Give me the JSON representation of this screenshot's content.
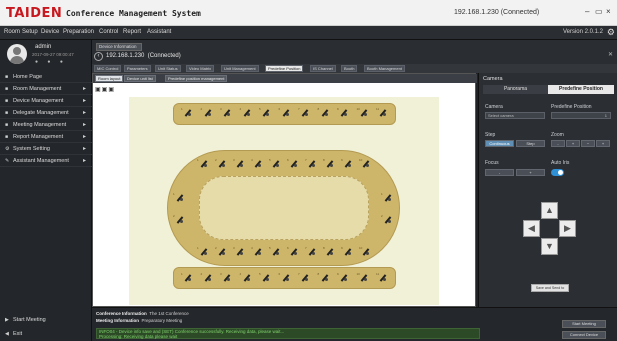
{
  "titlebar": {
    "brand": "TAIDEN",
    "title": "Conference Management System",
    "connection": "192.168.1.230 (Connected)"
  },
  "menubar": {
    "items": [
      "Room",
      "Setup",
      "Device",
      "Preparation",
      "Control",
      "Report",
      "Assistant"
    ],
    "version": "Version 2.0.1.2"
  },
  "user": {
    "name": "admin",
    "date": "2017-09-27 09:00:47",
    "icons": "● ● ●"
  },
  "sidebar": {
    "items": [
      {
        "label": "Home Page",
        "icon": "home-icon"
      },
      {
        "label": "Room Management",
        "icon": "room-icon"
      },
      {
        "label": "Device Management",
        "icon": "device-icon"
      },
      {
        "label": "Delegate Management",
        "icon": "delegate-icon"
      },
      {
        "label": "Meeting Management",
        "icon": "meeting-icon"
      },
      {
        "label": "Report Management",
        "icon": "report-icon"
      },
      {
        "label": "System Setting",
        "icon": "gear-icon"
      },
      {
        "label": "Assistant Management",
        "icon": "assistant-icon"
      }
    ],
    "start_meeting": "Start Meeting",
    "exit": "Exit"
  },
  "infobar": {
    "device_tab": "Device Information",
    "ip": "192.168.1.230",
    "status": "(Connected)"
  },
  "tabs": [
    "MIC Control",
    "Parameters",
    "Unit Status",
    "Video Matrix",
    "Unit Management",
    "Predefine Position",
    "IS Channel",
    "Booth",
    "Booth Management"
  ],
  "active_tab_index": 5,
  "workspace_tabs": [
    "Room layout",
    "Device unit list",
    "Predefine position management"
  ],
  "microphones": {
    "top_row": [
      1,
      2,
      3,
      4,
      5,
      6,
      7,
      8,
      9,
      10,
      11
    ],
    "bottom_row": [
      1,
      2,
      3,
      4,
      5,
      6,
      7,
      8,
      9,
      10,
      11
    ],
    "oval_top": [
      1,
      2,
      3,
      4,
      5,
      6,
      7,
      8,
      9,
      10
    ],
    "oval_bottom": [
      1,
      2,
      3,
      4,
      5,
      6,
      7,
      8,
      9,
      10
    ],
    "oval_left": [
      1,
      2
    ],
    "oval_right": [
      1,
      2
    ]
  },
  "right_panel": {
    "title": "Camera",
    "tabs": [
      "Panorama",
      "Predefine Position"
    ],
    "camera_label": "Camera",
    "camera_select": "Select camera",
    "predefine_label": "Predefine Position",
    "predefine_value": "1",
    "step_label": "Step",
    "step_buttons": [
      "Continuous",
      "Step"
    ],
    "zoom_label": "Zoom",
    "zoom_buttons": [
      "-",
      "+",
      "−",
      "+"
    ],
    "focus_label": "Focus",
    "focus_buttons": [
      "-",
      "+"
    ],
    "autoiris_label": "Auto Iris",
    "preset_button": "Save and Send to PTZ"
  },
  "bottom": {
    "line1_label": "Conference Information",
    "line1_value": "The 1st Conference",
    "line2_label": "Meeting Information",
    "line2_value": "Preparatory Meeting",
    "status_text": "INFO04 - Device info save and (SET) Conference successfully. Receiving data, please wait...",
    "status_text2": "Processing: Receiving data please wait",
    "btn_start": "Start Meeting",
    "btn_device": "Connect Device"
  }
}
